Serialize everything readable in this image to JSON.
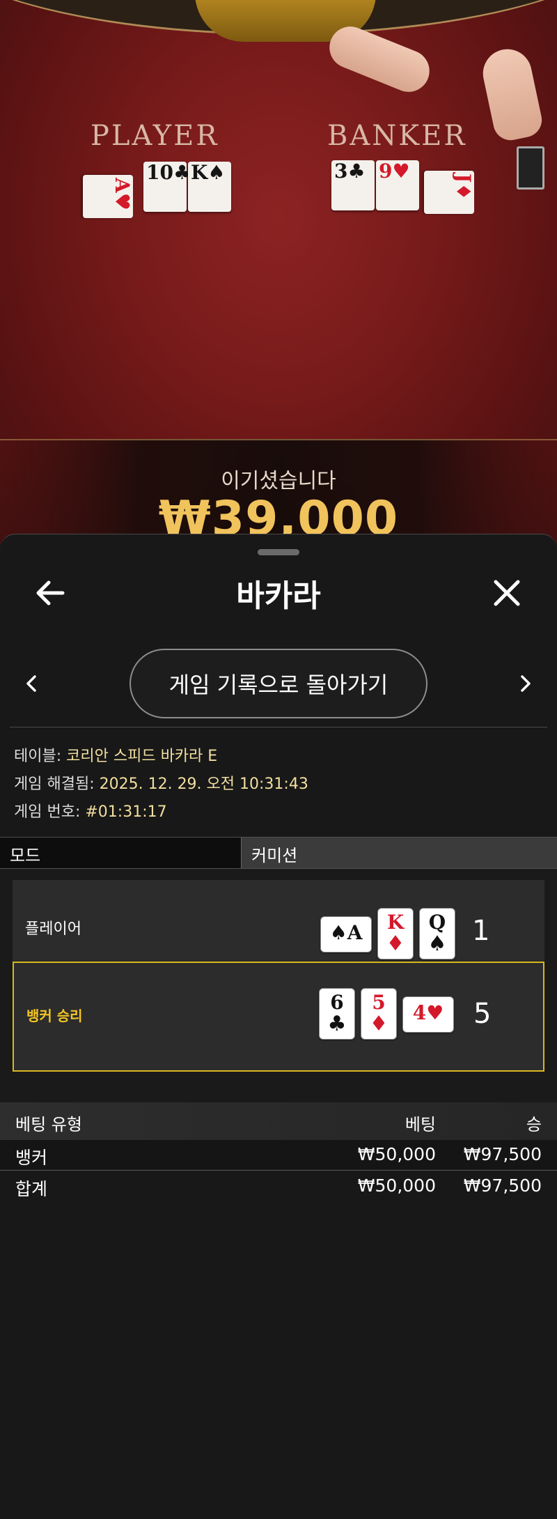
{
  "table": {
    "player_label": "PLAYER",
    "banker_label": "BANKER",
    "player_cards": [
      {
        "rank": "A",
        "suit": "♥",
        "color": "red",
        "rotated": true
      },
      {
        "rank": "10",
        "suit": "♣",
        "color": "black",
        "rotated": false
      },
      {
        "rank": "K",
        "suit": "♠",
        "color": "black",
        "rotated": false
      }
    ],
    "banker_cards": [
      {
        "rank": "3",
        "suit": "♣",
        "color": "black",
        "rotated": false
      },
      {
        "rank": "9",
        "suit": "♥",
        "color": "red",
        "rotated": false
      },
      {
        "rank": "J",
        "suit": "♦",
        "color": "red",
        "rotated": true
      }
    ],
    "win_text": "이기셨습니다",
    "win_amount": "₩39,000"
  },
  "sheet": {
    "title": "바카라",
    "back_icon": "arrow-left-icon",
    "close_icon": "close-x-icon",
    "prev_icon": "chevron-left-icon",
    "next_icon": "chevron-right-icon",
    "history_button": "게임 기록으로 돌아가기"
  },
  "info": {
    "table_label": "테이블:",
    "table_value": "코리안 스피드 바카라 E",
    "resolved_label": "게임 해결됨:",
    "resolved_value": "2025. 12. 29. 오전 10:31:43",
    "number_label": "게임 번호:",
    "number_value": "#01:31:17"
  },
  "mode": {
    "label": "모드",
    "value": "커미션"
  },
  "result": {
    "player": {
      "label": "플레이어",
      "score": "1",
      "cards": [
        {
          "rank": "A",
          "suit": "♠",
          "color": "black",
          "side": true
        },
        {
          "rank": "K",
          "suit": "♦",
          "color": "red",
          "side": false
        },
        {
          "rank": "Q",
          "suit": "♠",
          "color": "black",
          "side": false
        }
      ]
    },
    "banker": {
      "label": "뱅커 승리",
      "score": "5",
      "cards": [
        {
          "rank": "6",
          "suit": "♣",
          "color": "black",
          "side": false
        },
        {
          "rank": "5",
          "suit": "♦",
          "color": "red",
          "side": false
        },
        {
          "rank": "4",
          "suit": "♥",
          "color": "red",
          "side": true
        }
      ]
    },
    "highlight_color": "#d9b81d"
  },
  "bets": {
    "headers": {
      "type": "베팅 유형",
      "bet": "베팅",
      "win": "승"
    },
    "rows": [
      {
        "type": "뱅커",
        "bet": "₩50,000",
        "win": "₩97,500"
      },
      {
        "type": "합계",
        "bet": "₩50,000",
        "win": "₩97,500"
      }
    ]
  }
}
